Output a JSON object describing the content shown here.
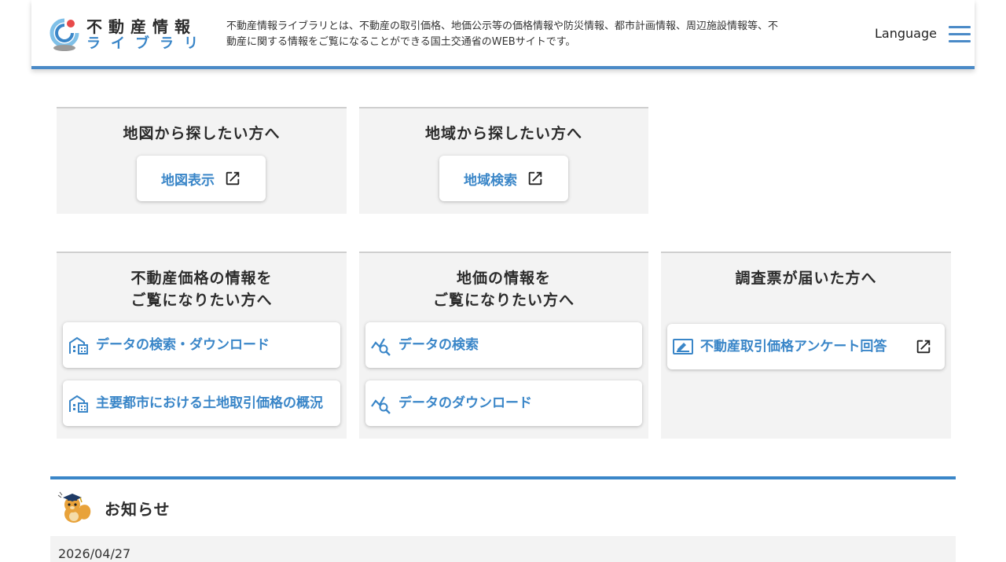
{
  "header": {
    "logo_line1": "不動産情報",
    "logo_line2": "ライブラリ",
    "tagline": "不動産情報ライブラリとは、不動産の取引価格、地価公示等の価格情報や防災情報、都市計画情報、周辺施設情報等、不動産に関する情報をご覧になることができる国土交通省のWEBサイトです。",
    "language_label": "Language"
  },
  "cards_top": [
    {
      "title": "地図から探したい方へ",
      "button": "地図表示"
    },
    {
      "title": "地域から探したい方へ",
      "button": "地域検索"
    }
  ],
  "cards_bottom": [
    {
      "title_line1": "不動産価格の情報を",
      "title_line2": "ご覧になりたい方へ",
      "buttons": [
        "データの検索・ダウンロード",
        "主要都市における土地取引価格の概況"
      ]
    },
    {
      "title_line1": "地価の情報を",
      "title_line2": "ご覧になりたい方へ",
      "buttons": [
        "データの検索",
        "データのダウンロード"
      ]
    },
    {
      "title_line1": "調査票が届いた方へ",
      "buttons": [
        "不動産取引価格アンケート回答"
      ]
    }
  ],
  "news": {
    "title": "お知らせ",
    "items": [
      {
        "date": "2026/04/27"
      }
    ]
  },
  "colors": {
    "accent": "#3a86c8",
    "card_bg": "#f3f3f3",
    "text": "#2b2b2b"
  }
}
